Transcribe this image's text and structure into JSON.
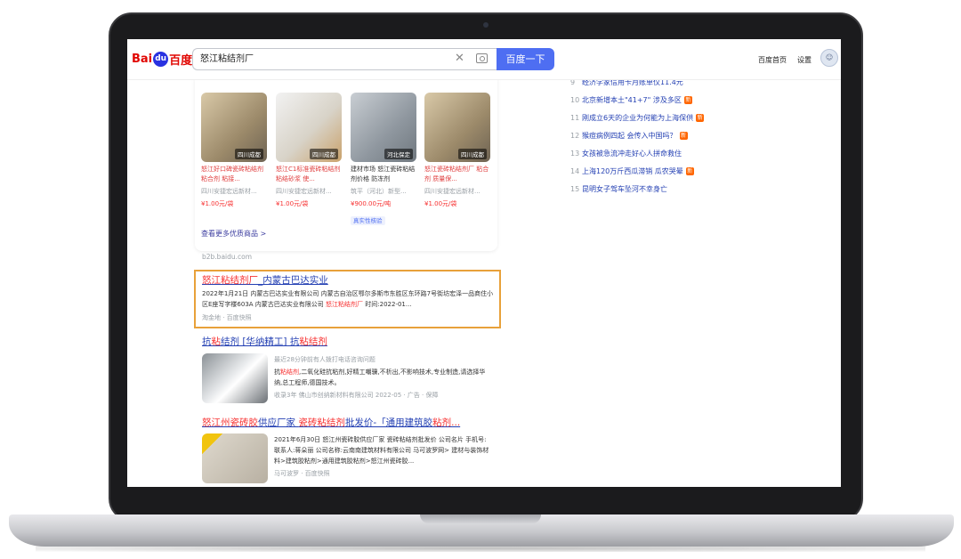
{
  "header": {
    "logo": {
      "bai": "Bai",
      "paw": "du",
      "du": "百度"
    },
    "search_value": "怒江粘结剂厂",
    "search_button": "百度一下",
    "nav_home": "百度首页",
    "nav_settings": "设置",
    "avatar": "头像"
  },
  "products": [
    {
      "region": "四川成都",
      "title": "怒江好口碑瓷砖粘结剂 粘合剂 粘接...",
      "seller": "四川安捷宏远新材...",
      "price": "¥1.00元/袋"
    },
    {
      "region": "四川成都",
      "title": "怒江C1标准瓷砖粘结剂 粘结砂浆 使...",
      "seller": "四川安捷宏远新材...",
      "price": "¥1.00元/袋"
    },
    {
      "region": "河北保定",
      "title": "建材市场 怒江瓷砖粘结剂价格 防冻剂",
      "seller": "筑平（河北）新型...",
      "price": "¥900.00元/吨",
      "badge": "真实性核验"
    },
    {
      "region": "四川成都",
      "title": "怒江瓷砖粘结剂厂 粘合剂 质量保...",
      "seller": "四川安捷宏远新材...",
      "price": "¥1.00元/袋"
    }
  ],
  "more_link": "查看更多优质商品 >",
  "site_source": "b2b.baidu.com",
  "results": [
    {
      "title_hl": "怒江粘结剂厂",
      "title_rest": "_内蒙古巴达实业",
      "abstract_a": "2022年1月21日 内蒙古巴达实业有限公司 内蒙古自治区鄂尔多斯市东胜区东环路7号街坊宏",
      "abstract_b": "泽一品商住小区E座写字楼603A 内蒙古巴达实业有限公司",
      "abstract_hl": "怒江粘结剂厂",
      "abstract_c": "时间:2022-01...",
      "meta": "淘金地 · 百度快照"
    },
    {
      "title_a": "抗",
      "title_hl1": "粘",
      "title_b": "结剂 [华纳精工] 抗",
      "title_hl2": "粘结剂",
      "notice": "最近28分钟前有人拨打电话咨询问题",
      "abstract_a": "抗",
      "abstract_hl": "粘结剂",
      "abstract_b": ",二氧化硅抗粘剂,好精工嘲骥,不析出,不影响技术,专业制造,请选择华纳,总工程师,德国技术。",
      "meta": "收录3年 佛山市创纳新材料有限公司 2022-05 · 广告 · 保障"
    },
    {
      "title_hl1": "怒江州瓷砖胶",
      "title_a": "供应厂家 ",
      "title_hl2": "瓷砖粘结剂",
      "title_b": "批发价-「通用建筑胶",
      "title_hl3": "粘剂...",
      "abstract": "2021年6月30日 怒江州瓷砖胶供应厂家 瓷砖粘结剂批发价 公司名片 手机号: 联系人:蒋朵丽 公司名称:云南南建筑材料有限公司 马可波罗网> 建材与装饰材料>建筑胶粘剂>通用建筑胶粘剂>怒江州瓷砖胶...",
      "meta": "马可波罗 · 百度快照"
    }
  ],
  "hot_list": [
    {
      "num": "9",
      "text": "经济学家信用卡月账单仅11.4元"
    },
    {
      "num": "10",
      "text": "北京新增本土\"41+7\" 涉及多区",
      "tag": "新"
    },
    {
      "num": "11",
      "text": "刚成立6天的企业为何能为上海保供",
      "tag": "新"
    },
    {
      "num": "12",
      "text": "猴痘病例四起 会传入中国吗？",
      "tag": "新"
    },
    {
      "num": "13",
      "text": "女孩被急流冲走好心人拼命救住"
    },
    {
      "num": "14",
      "text": "上海120万斤西瓜滞销 瓜农哭晕",
      "tag": "新"
    },
    {
      "num": "15",
      "text": "昆明女子驾车坠河不幸身亡"
    }
  ]
}
